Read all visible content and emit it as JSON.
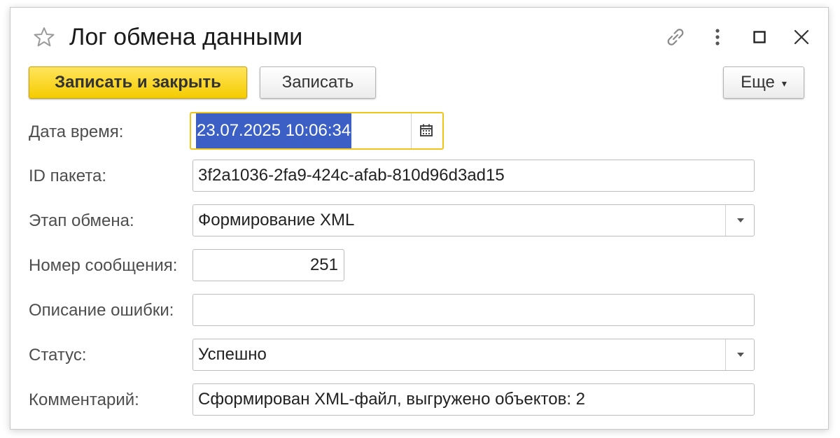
{
  "window": {
    "title": "Лог обмена данными"
  },
  "toolbar": {
    "save_close_label": "Записать и закрыть",
    "save_label": "Записать",
    "more_label": "Еще"
  },
  "form": {
    "datetime": {
      "label": "Дата время:",
      "value": "23.07.2025 10:06:34"
    },
    "package_id": {
      "label": "ID пакета:",
      "value": "3f2a1036-2fa9-424c-afab-810d96d3ad15"
    },
    "exchange_stage": {
      "label": "Этап обмена:",
      "value": "Формирование XML"
    },
    "message_number": {
      "label": "Номер сообщения:",
      "value": "251"
    },
    "error_description": {
      "label": "Описание ошибки:",
      "value": ""
    },
    "status": {
      "label": "Статус:",
      "value": "Успешно"
    },
    "comment": {
      "label": "Комментарий:",
      "value": "Сформирован XML-файл, выгружено объектов: 2"
    }
  },
  "colors": {
    "primary_button": "#f5cc00",
    "focus_border": "#f0c419",
    "selection": "#3b5fc4"
  },
  "icons": [
    "star-icon",
    "link-icon",
    "more-vertical-icon",
    "maximize-icon",
    "close-icon",
    "calendar-icon",
    "chevron-down-icon"
  ]
}
